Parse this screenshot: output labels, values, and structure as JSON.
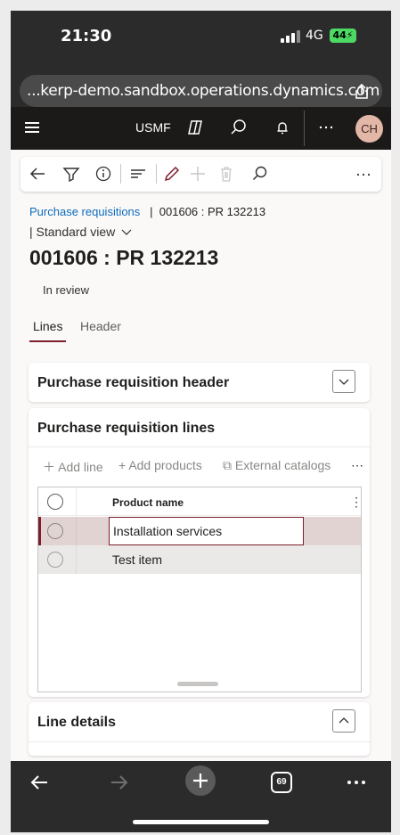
{
  "status_bar": {
    "time": "21:30",
    "network": "4G",
    "battery": "44"
  },
  "browser": {
    "url": "...kerp-demo.sandbox.operations.dynamics.com",
    "tab_count": "69"
  },
  "app_header": {
    "company": "USMF",
    "avatar_initials": "CH"
  },
  "toolbar": {
    "icons": [
      "back-arrow-icon",
      "filter-icon",
      "info-icon",
      "list-icon",
      "edit-pencil-icon",
      "add-icon",
      "delete-trash-icon",
      "search-icon",
      "more-icon"
    ]
  },
  "breadcrumb": {
    "link": "Purchase requisitions",
    "separator": "|",
    "current": "001606 : PR 132213",
    "view": "| Standard view"
  },
  "page": {
    "title": "001606 : PR 132213",
    "status": "In review"
  },
  "tabs": [
    {
      "label": "Lines"
    },
    {
      "label": "Header"
    }
  ],
  "sections": {
    "header_card": "Purchase requisition header",
    "lines_card": "Purchase requisition lines",
    "line_details": "Line details"
  },
  "grid": {
    "actions": {
      "add_line": "Add line",
      "add_products": "Add products",
      "external_catalogs": "External catalogs"
    },
    "column_header": "Product name",
    "rows": [
      {
        "product_name": "Installation services",
        "selected": true
      },
      {
        "product_name": "Test item",
        "selected": false
      }
    ]
  },
  "colors": {
    "accent": "#7a1e2b",
    "link": "#0f6cbd",
    "app_bar": "#1b1a19",
    "selected_row": "#e2d3d3",
    "row": "#ebe9e7"
  }
}
